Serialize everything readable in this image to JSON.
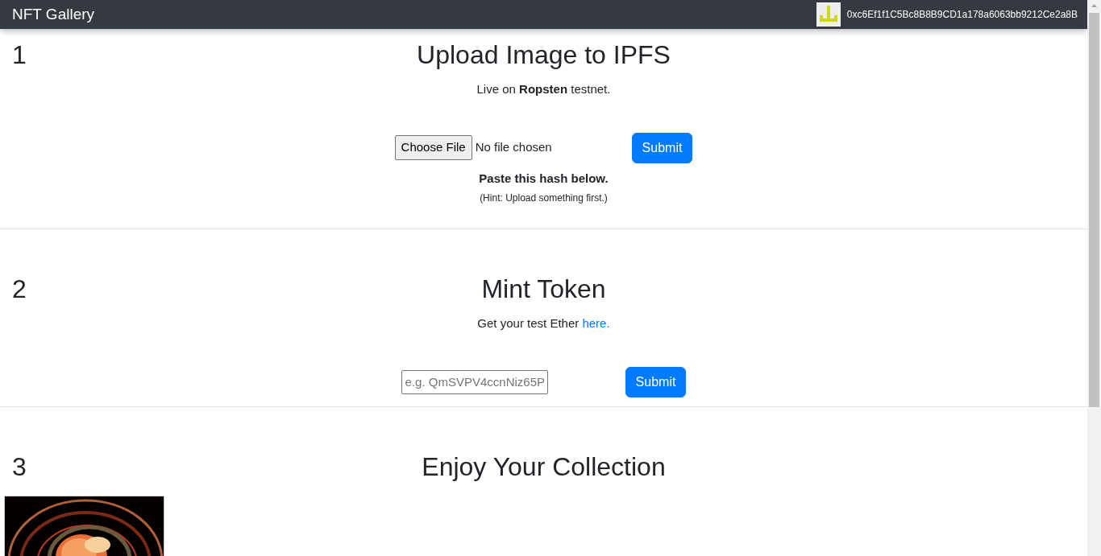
{
  "navbar": {
    "brand": "NFT Gallery",
    "account": "0xc6Ef1f1C5Bc8B8B9CD1a178a6063bb9212Ce2a8B"
  },
  "sections": [
    {
      "number": "1",
      "title": "Upload Image to IPFS",
      "subtitle": "Live on **Ropsten** testnet.",
      "kind": "upload",
      "file_button": "Choose File",
      "file_status": "No file chosen",
      "submit": "Submit",
      "note": "Paste this hash below.",
      "hint": "(Hint: Upload something first.)"
    },
    {
      "number": "2",
      "title": "Mint Token",
      "subtitle": "Get your test Ether",
      "link": "here.",
      "kind": "mint",
      "placeholder": "e.g. QmSVPV4ccnNiz65P",
      "submit": "Submit"
    },
    {
      "number": "3",
      "title": "Enjoy Your Collection",
      "kind": "gallery"
    }
  ]
}
